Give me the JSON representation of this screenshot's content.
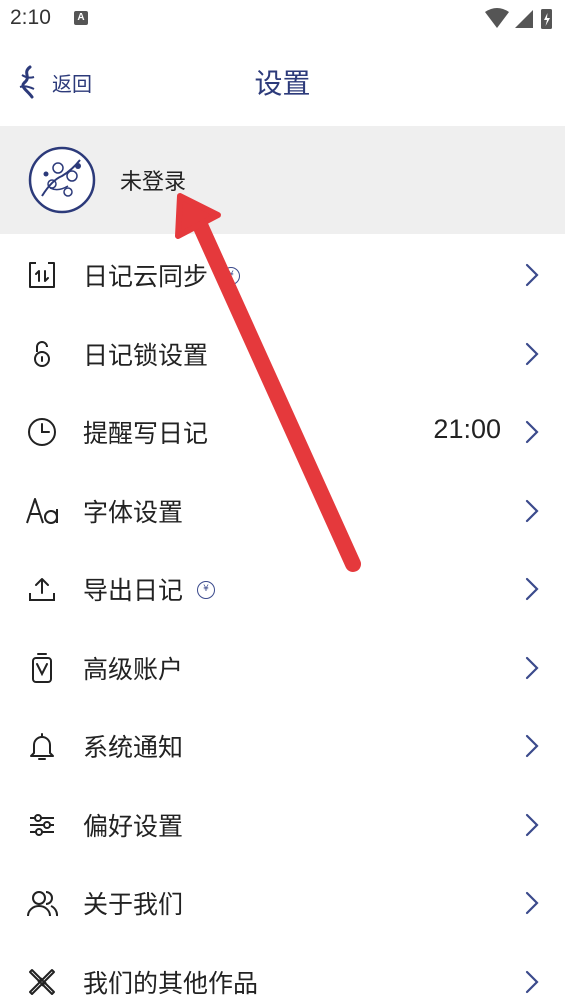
{
  "status_bar": {
    "time": "2:10",
    "notif_letter": "A"
  },
  "header": {
    "back_label": "返回",
    "title": "设置"
  },
  "user": {
    "name": "未登录"
  },
  "vip_symbol": "¥",
  "settings": [
    {
      "label": "日记云同步",
      "icon": "cloud-sync-icon",
      "vip": true,
      "value": ""
    },
    {
      "label": "日记锁设置",
      "icon": "lock-icon",
      "vip": false,
      "value": ""
    },
    {
      "label": "提醒写日记",
      "icon": "clock-icon",
      "vip": false,
      "value": "21:00"
    },
    {
      "label": "字体设置",
      "icon": "font-icon",
      "vip": false,
      "value": ""
    },
    {
      "label": "导出日记",
      "icon": "export-icon",
      "vip": true,
      "value": ""
    },
    {
      "label": "高级账户",
      "icon": "premium-icon",
      "vip": false,
      "value": ""
    },
    {
      "label": "系统通知",
      "icon": "bell-icon",
      "vip": false,
      "value": ""
    },
    {
      "label": "偏好设置",
      "icon": "sliders-icon",
      "vip": false,
      "value": ""
    },
    {
      "label": "关于我们",
      "icon": "people-icon",
      "vip": false,
      "value": ""
    },
    {
      "label": "我们的其他作品",
      "icon": "tools-icon",
      "vip": false,
      "value": ""
    }
  ],
  "colors": {
    "accent": "#2c3a7a",
    "card_bg": "#efefef",
    "annotation_arrow": "#e5393c"
  }
}
